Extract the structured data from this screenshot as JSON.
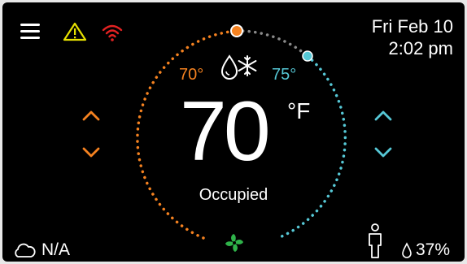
{
  "header": {
    "date": "Fri Feb 10",
    "time": "2:02 pm"
  },
  "setpoints": {
    "heat": "70°",
    "cool": "75°"
  },
  "current": {
    "temperature": "70",
    "unit": "°F",
    "status": "Occupied"
  },
  "footer": {
    "outdoor": "N/A",
    "humidity": "37%"
  },
  "colors": {
    "heat": "#f58220",
    "cool": "#56c8d6",
    "fan": "#2fb34a",
    "warning": "#e6e000",
    "wifi": "#e32222"
  },
  "icons": [
    "menu-icon",
    "warning-icon",
    "wifi-icon",
    "heat-cool-mode-icon",
    "fan-icon",
    "cloud-icon",
    "person-icon",
    "humidity-drop-icon"
  ]
}
